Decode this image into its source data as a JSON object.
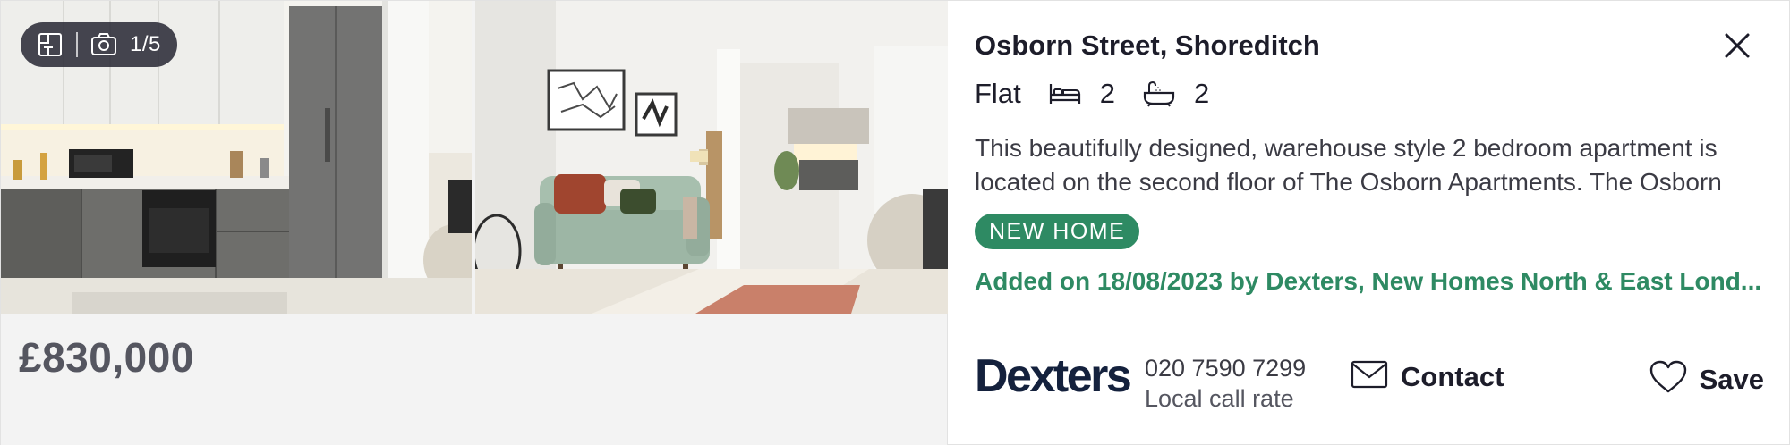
{
  "media": {
    "floorplan_icon": "floorplan-icon",
    "camera_icon": "camera-icon",
    "photo_counter": "1/5"
  },
  "listing": {
    "price": "£830,000",
    "address": "Osborn Street, Shoreditch",
    "property_type": "Flat",
    "bedrooms": "2",
    "bathrooms": "2",
    "description_line_1": "This beautifully designed, warehouse style 2 bedroom apartment is",
    "description_line_2": "located on the second floor of The Osborn Apartments. The Osborn",
    "badge": "NEW HOME",
    "added_text": "Added on 18/08/2023 by Dexters, New Homes North & East Lond..."
  },
  "agent": {
    "logo_text": "Dexters",
    "phone": "020 7590 7299",
    "rate_note": "Local call rate"
  },
  "actions": {
    "contact_label": "Contact",
    "save_label": "Save"
  },
  "colors": {
    "accent_green": "#2e8a63",
    "text_dark": "#1d1d2a",
    "agent_navy": "#14213d",
    "price_grey": "#555660"
  }
}
